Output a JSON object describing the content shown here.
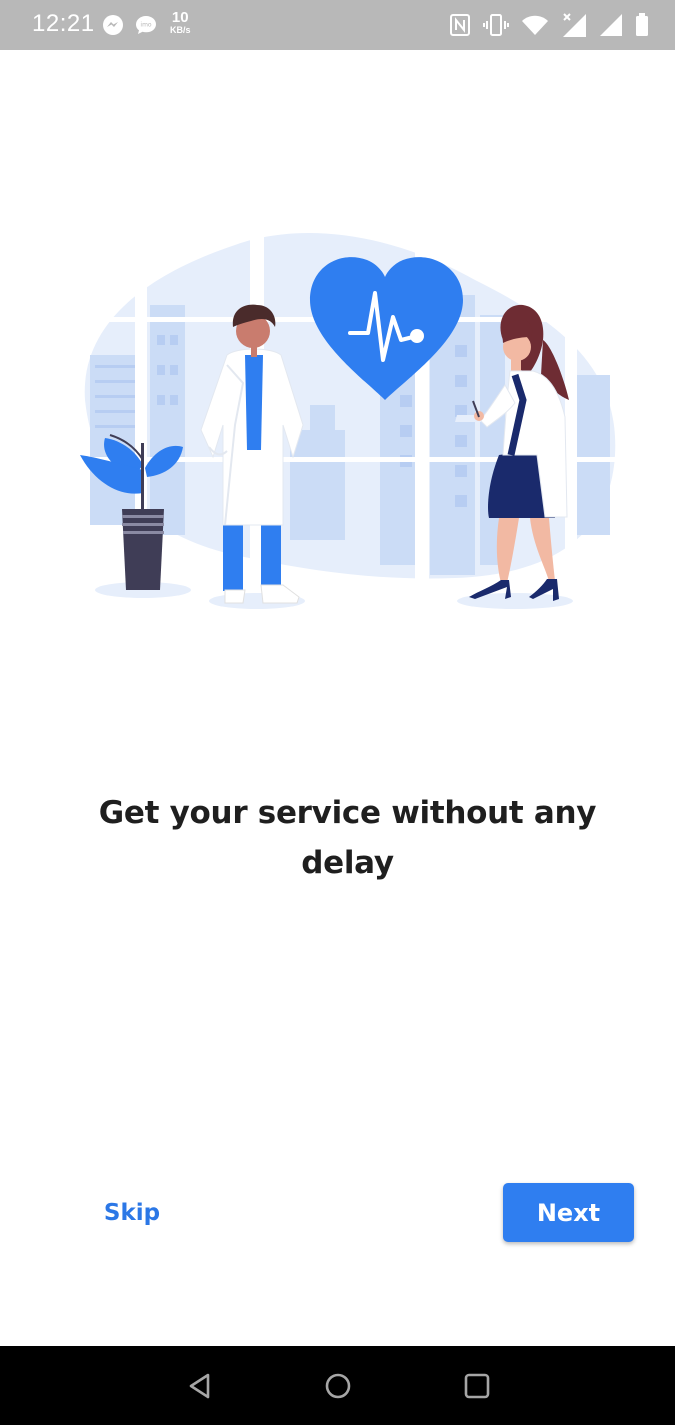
{
  "status_bar": {
    "time": "12:21",
    "net_speed_value": "10",
    "net_speed_unit": "KB/s",
    "left_icons": [
      "messenger-icon",
      "imo-icon"
    ],
    "right_icons": [
      "nfc-icon",
      "vibrate-icon",
      "wifi-icon",
      "signal-x-icon",
      "signal-icon",
      "battery-icon"
    ]
  },
  "onboarding": {
    "illustration_icon": "doctors-heart-illustration",
    "title": "Get your service without any delay",
    "skip_label": "Skip",
    "next_label": "Next"
  },
  "nav_bar": {
    "icons": [
      "back-icon",
      "home-icon",
      "recents-icon"
    ]
  },
  "colors": {
    "accent": "#2f7ef0",
    "skip_text": "#2b77e6",
    "status_bar": "#b8b8b8",
    "title_text": "#1f1f1f",
    "nav_bar": "#000000"
  }
}
